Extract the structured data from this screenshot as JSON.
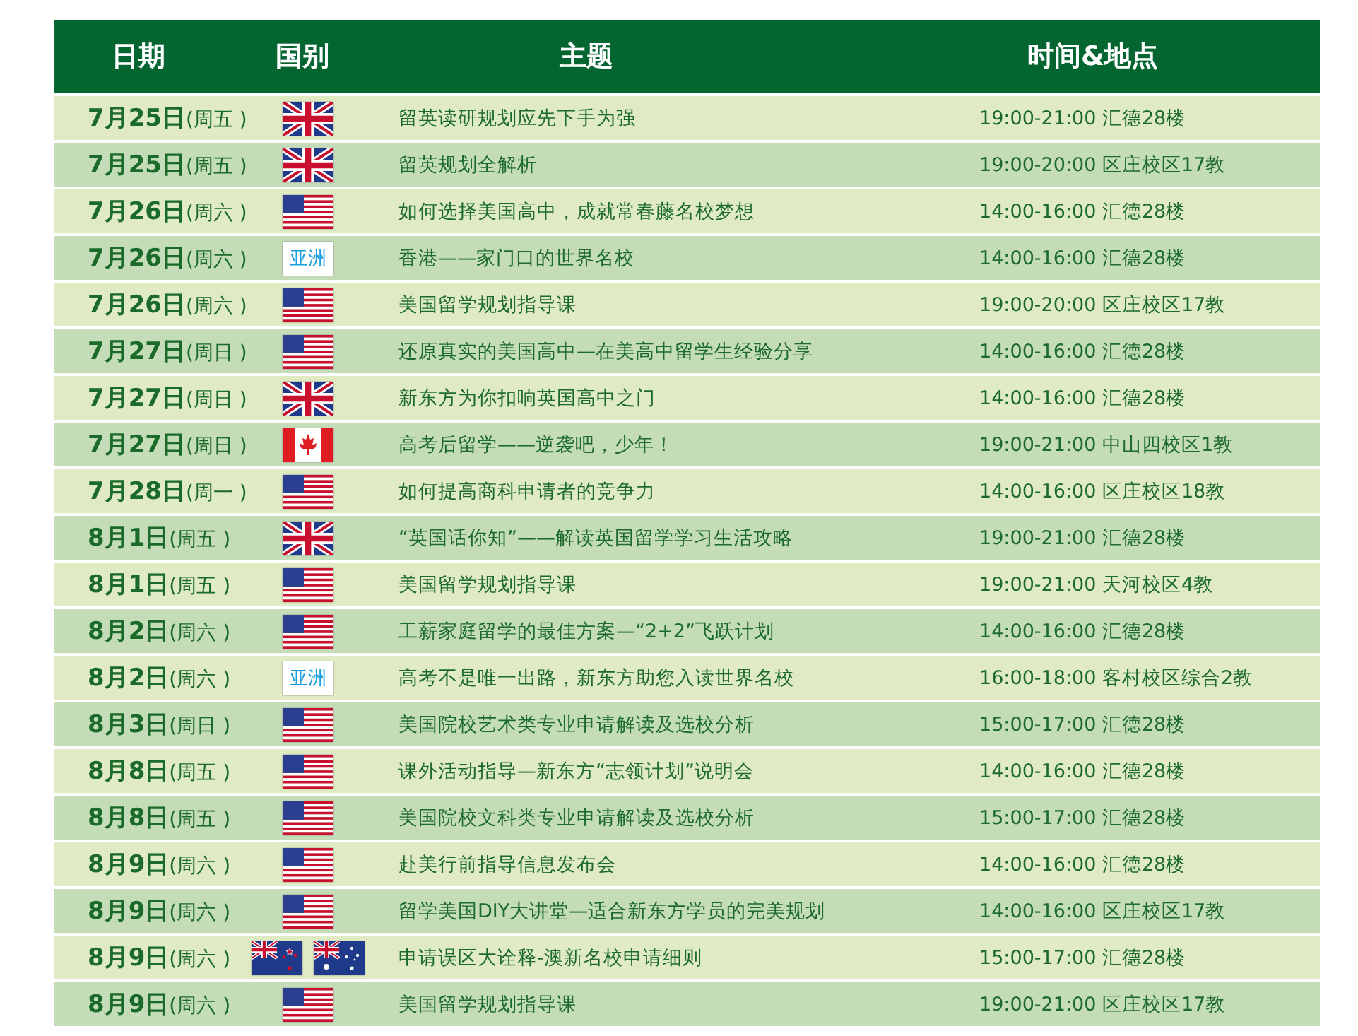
{
  "table": {
    "columns": [
      "日期",
      "国别",
      "主题",
      "时间&地点"
    ],
    "rows": [
      {
        "date": "7月25日",
        "weekday": "(周五 )",
        "flags": [
          {
            "kind": "uk"
          }
        ],
        "topic": "留英读研规划应先下手为强",
        "time_place": "19:00-21:00 汇德28楼"
      },
      {
        "date": "7月25日",
        "weekday": "(周五 )",
        "flags": [
          {
            "kind": "uk"
          }
        ],
        "topic": "留英规划全解析",
        "time_place": "19:00-20:00 区庄校区17教"
      },
      {
        "date": "7月26日",
        "weekday": "(周六 )",
        "flags": [
          {
            "kind": "us"
          }
        ],
        "topic": "如何选择美国高中，成就常春藤名校梦想",
        "time_place": "14:00-16:00 汇德28楼"
      },
      {
        "date": "7月26日",
        "weekday": "(周六 )",
        "flags": [
          {
            "kind": "region",
            "label": "亚洲"
          }
        ],
        "topic": "香港——家门口的世界名校",
        "time_place": "14:00-16:00 汇德28楼"
      },
      {
        "date": "7月26日",
        "weekday": "(周六 )",
        "flags": [
          {
            "kind": "us"
          }
        ],
        "topic": "美国留学规划指导课",
        "time_place": "19:00-20:00 区庄校区17教"
      },
      {
        "date": "7月27日",
        "weekday": "(周日 )",
        "flags": [
          {
            "kind": "us"
          }
        ],
        "topic": "还原真实的美国高中—在美高中留学生经验分享",
        "time_place": "14:00-16:00 汇德28楼"
      },
      {
        "date": "7月27日",
        "weekday": "(周日 )",
        "flags": [
          {
            "kind": "uk"
          }
        ],
        "topic": "新东方为你扣响英国高中之门",
        "time_place": "14:00-16:00 汇德28楼"
      },
      {
        "date": "7月27日",
        "weekday": "(周日 )",
        "flags": [
          {
            "kind": "canada"
          }
        ],
        "topic": "高考后留学——逆袭吧，少年！",
        "time_place": "19:00-21:00 中山四校区1教"
      },
      {
        "date": "7月28日",
        "weekday": "(周一 )",
        "flags": [
          {
            "kind": "us"
          }
        ],
        "topic": "如何提高商科申请者的竞争力",
        "time_place": "14:00-16:00 区庄校区18教"
      },
      {
        "date": "8月1日",
        "weekday": "(周五 )",
        "flags": [
          {
            "kind": "uk"
          }
        ],
        "topic": "“英国话你知”——解读英国留学学习生活攻略",
        "time_place": "19:00-21:00 汇德28楼"
      },
      {
        "date": "8月1日",
        "weekday": "(周五 )",
        "flags": [
          {
            "kind": "us"
          }
        ],
        "topic": "美国留学规划指导课",
        "time_place": "19:00-21:00 天河校区4教"
      },
      {
        "date": "8月2日",
        "weekday": "(周六 )",
        "flags": [
          {
            "kind": "us"
          }
        ],
        "topic": "工薪家庭留学的最佳方案—“2+2”飞跃计划",
        "time_place": "14:00-16:00 汇德28楼"
      },
      {
        "date": "8月2日",
        "weekday": "(周六 )",
        "flags": [
          {
            "kind": "region",
            "label": "亚洲"
          }
        ],
        "topic": "高考不是唯一出路，新东方助您入读世界名校",
        "time_place": "16:00-18:00 客村校区综合2教"
      },
      {
        "date": "8月3日",
        "weekday": "(周日 )",
        "flags": [
          {
            "kind": "us"
          }
        ],
        "topic": "美国院校艺术类专业申请解读及选校分析",
        "time_place": "15:00-17:00 汇德28楼"
      },
      {
        "date": "8月8日",
        "weekday": "(周五 )",
        "flags": [
          {
            "kind": "us"
          }
        ],
        "topic": "课外活动指导—新东方“志领计划”说明会",
        "time_place": "14:00-16:00 汇德28楼"
      },
      {
        "date": "8月8日",
        "weekday": "(周五 )",
        "flags": [
          {
            "kind": "us"
          }
        ],
        "topic": "美国院校文科类专业申请解读及选校分析",
        "time_place": "15:00-17:00 汇德28楼"
      },
      {
        "date": "8月9日",
        "weekday": "(周六 )",
        "flags": [
          {
            "kind": "us"
          }
        ],
        "topic": "赴美行前指导信息发布会",
        "time_place": "14:00-16:00 汇德28楼"
      },
      {
        "date": "8月9日",
        "weekday": "(周六 )",
        "flags": [
          {
            "kind": "us"
          }
        ],
        "topic": "留学美国DIY大讲堂—适合新东方学员的完美规划",
        "time_place": "14:00-16:00 区庄校区17教"
      },
      {
        "date": "8月9日",
        "weekday": "(周六 )",
        "flags": [
          {
            "kind": "nz"
          },
          {
            "kind": "au"
          }
        ],
        "topic": "申请误区大诠释-澳新名校申请细则",
        "time_place": "15:00-17:00 汇德28楼"
      },
      {
        "date": "8月9日",
        "weekday": "(周六 )",
        "flags": [
          {
            "kind": "us"
          }
        ],
        "topic": "美国留学规划指导课",
        "time_place": "19:00-21:00 区庄校区17教"
      }
    ]
  }
}
